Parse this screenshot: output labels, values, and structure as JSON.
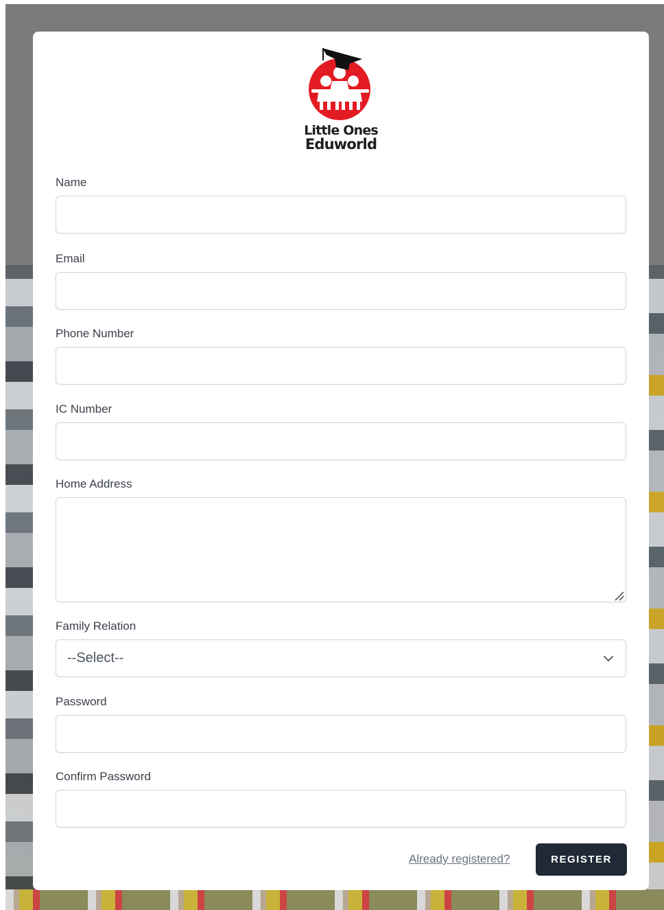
{
  "brand": {
    "line1": "Little Ones",
    "line2": "Eduworld",
    "accent_color": "#e31b23"
  },
  "form": {
    "name": {
      "label": "Name",
      "value": ""
    },
    "email": {
      "label": "Email",
      "value": ""
    },
    "phone": {
      "label": "Phone Number",
      "value": ""
    },
    "ic": {
      "label": "IC Number",
      "value": ""
    },
    "address": {
      "label": "Home Address",
      "value": ""
    },
    "relation": {
      "label": "Family Relation",
      "selected": "--Select--"
    },
    "password": {
      "label": "Password",
      "value": ""
    },
    "confirm_password": {
      "label": "Confirm Password",
      "value": ""
    }
  },
  "actions": {
    "login_link": "Already registered?",
    "register_button": "REGISTER",
    "button_color": "#1f2937"
  },
  "icons": {
    "select": "chevron-down-icon",
    "resize": "resize-handle-icon"
  }
}
